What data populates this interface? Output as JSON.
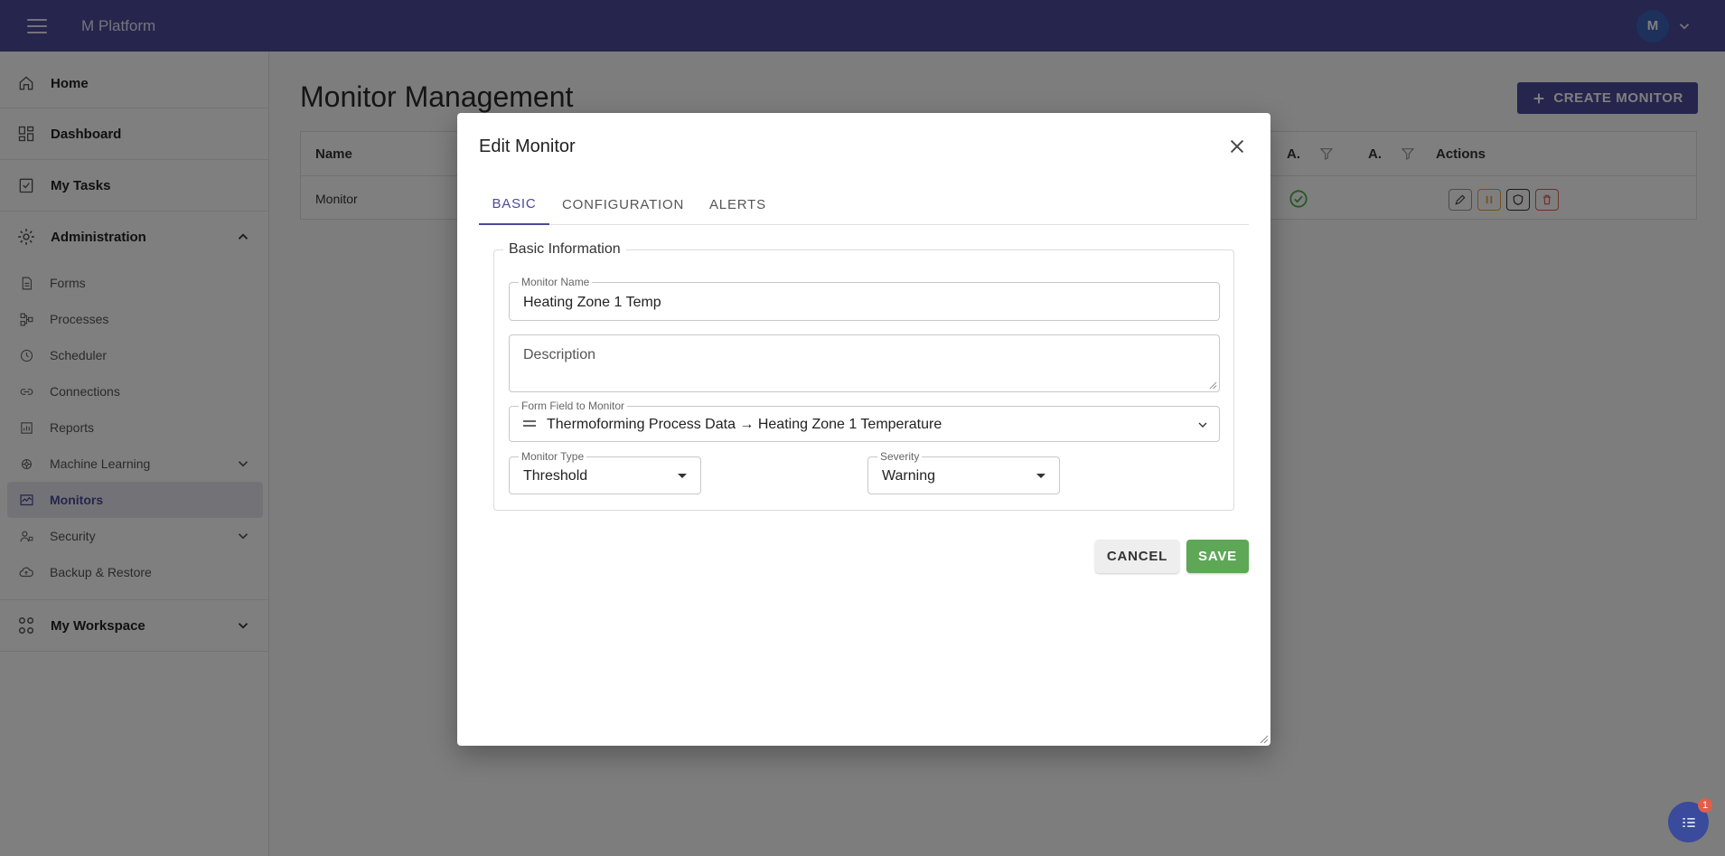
{
  "app": {
    "title": "M Platform",
    "user_initial": "M"
  },
  "sidebar": {
    "items": [
      {
        "label": "Home",
        "icon": "home-icon"
      },
      {
        "label": "Dashboard",
        "icon": "dashboard-icon"
      },
      {
        "label": "My Tasks",
        "icon": "tasks-icon"
      },
      {
        "label": "Administration",
        "icon": "gear-icon"
      },
      {
        "label": "Forms",
        "icon": "form-icon"
      },
      {
        "label": "Processes",
        "icon": "process-icon"
      },
      {
        "label": "Scheduler",
        "icon": "clock-icon"
      },
      {
        "label": "Connections",
        "icon": "link-icon"
      },
      {
        "label": "Reports",
        "icon": "report-icon"
      },
      {
        "label": "Machine Learning",
        "icon": "brain-icon"
      },
      {
        "label": "Monitors",
        "icon": "monitor-icon"
      },
      {
        "label": "Security",
        "icon": "security-icon"
      },
      {
        "label": "Backup & Restore",
        "icon": "cloud-icon"
      },
      {
        "label": "My Workspace",
        "icon": "workspace-icon"
      }
    ]
  },
  "main": {
    "title": "Monitor Management",
    "create_button": "CREATE MONITOR",
    "table": {
      "columns": [
        "Name",
        "A.",
        "A.",
        "Actions"
      ],
      "rows": [
        {
          "name": "Monitor"
        }
      ]
    }
  },
  "dialog": {
    "title": "Edit Monitor",
    "tabs": [
      "BASIC",
      "CONFIGURATION",
      "ALERTS"
    ],
    "section": "Basic Information",
    "monitor_name_label": "Monitor Name",
    "monitor_name_value": "Heating Zone 1 Temp",
    "description_placeholder": "Description",
    "form_field_label": "Form Field to Monitor",
    "form_field_value": "Thermoforming Process Data → Heating Zone 1 Temperature",
    "monitor_type_label": "Monitor Type",
    "monitor_type_value": "Threshold",
    "severity_label": "Severity",
    "severity_value": "Warning",
    "cancel_label": "CANCEL",
    "save_label": "SAVE"
  },
  "notifications": {
    "count": "1"
  },
  "colors": {
    "primary": "#4a4a9c",
    "save": "#5ea757",
    "success": "#4caf50",
    "danger": "#e35d4a",
    "warning": "#e8a13a"
  }
}
